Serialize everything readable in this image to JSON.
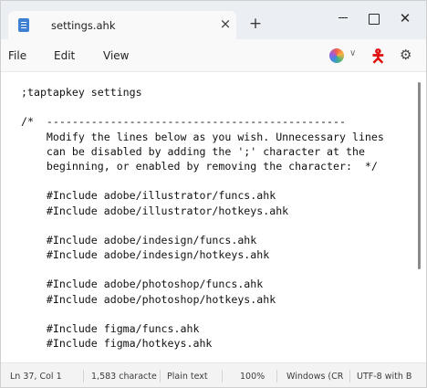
{
  "tab": {
    "title": "settings.ahk",
    "close_glyph": "×",
    "new_tab_glyph": "+"
  },
  "window_controls": {
    "close_glyph": "✕"
  },
  "menu": {
    "file": "File",
    "edit": "Edit",
    "view": "View"
  },
  "toolbar_icons": [
    "copilot-icon",
    "chevron-down-icon",
    "person-icon",
    "gear-icon"
  ],
  "editor": {
    "lines": [
      ";taptapkey settings",
      "",
      "/*  -----------------------------------------------",
      "    Modify the lines below as you wish. Unnecessary lines",
      "    can be disabled by adding the ';' character at the",
      "    beginning, or enabled by removing the character:  */",
      "",
      "    #Include adobe/illustrator/funcs.ahk",
      "    #Include adobe/illustrator/hotkeys.ahk",
      "",
      "    #Include adobe/indesign/funcs.ahk",
      "    #Include adobe/indesign/hotkeys.ahk",
      "",
      "    #Include adobe/photoshop/funcs.ahk",
      "    #Include adobe/photoshop/hotkeys.ahk",
      "",
      "    #Include figma/funcs.ahk",
      "    #Include figma/hotkeys.ahk"
    ]
  },
  "status": {
    "position": "Ln 37, Col 1",
    "chars": "1,583 characte",
    "format": "Plain text",
    "zoom": "100%",
    "line_ending": "Windows (CR",
    "encoding": "UTF-8 with B"
  }
}
